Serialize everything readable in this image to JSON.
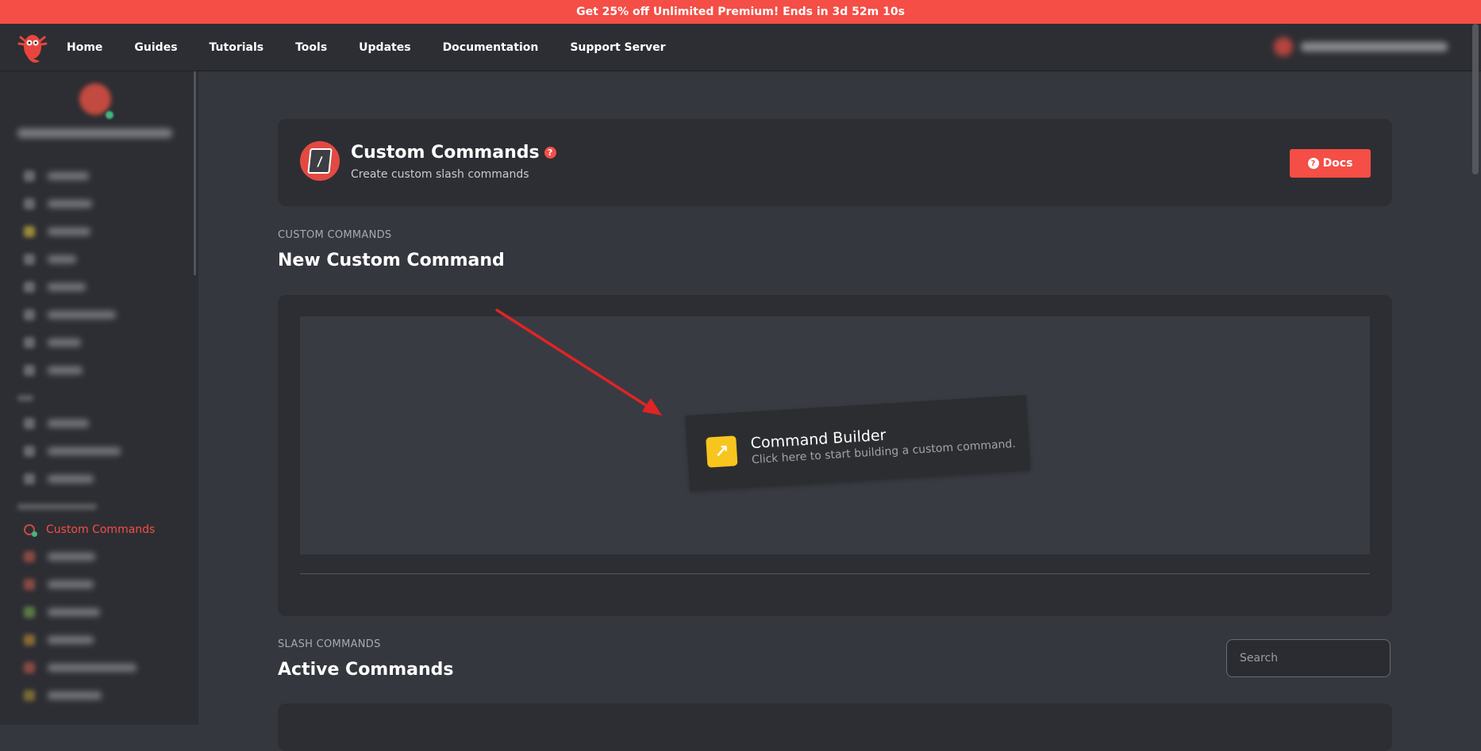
{
  "promo": {
    "text": "Get 25% off Unlimited Premium! Ends in 3d 52m 10s"
  },
  "nav": {
    "links": [
      "Home",
      "Guides",
      "Tutorials",
      "Tools",
      "Updates",
      "Documentation",
      "Support Server"
    ]
  },
  "sidebar": {
    "active_item": "Custom Commands"
  },
  "module": {
    "title": "Custom Commands",
    "subtitle": "Create custom slash commands",
    "docs_button": "Docs",
    "help_glyph": "?"
  },
  "new_command": {
    "section_label": "CUSTOM COMMANDS",
    "section_title": "New Custom Command",
    "builder_title": "Command Builder",
    "builder_subtitle": "Click here to start building a custom command."
  },
  "active_commands": {
    "section_label": "SLASH COMMANDS",
    "section_title": "Active Commands",
    "search_placeholder": "Search"
  },
  "colors": {
    "accent": "#f44e46",
    "builder_icon": "#f7c51e",
    "annotation_arrow": "#e02424"
  }
}
